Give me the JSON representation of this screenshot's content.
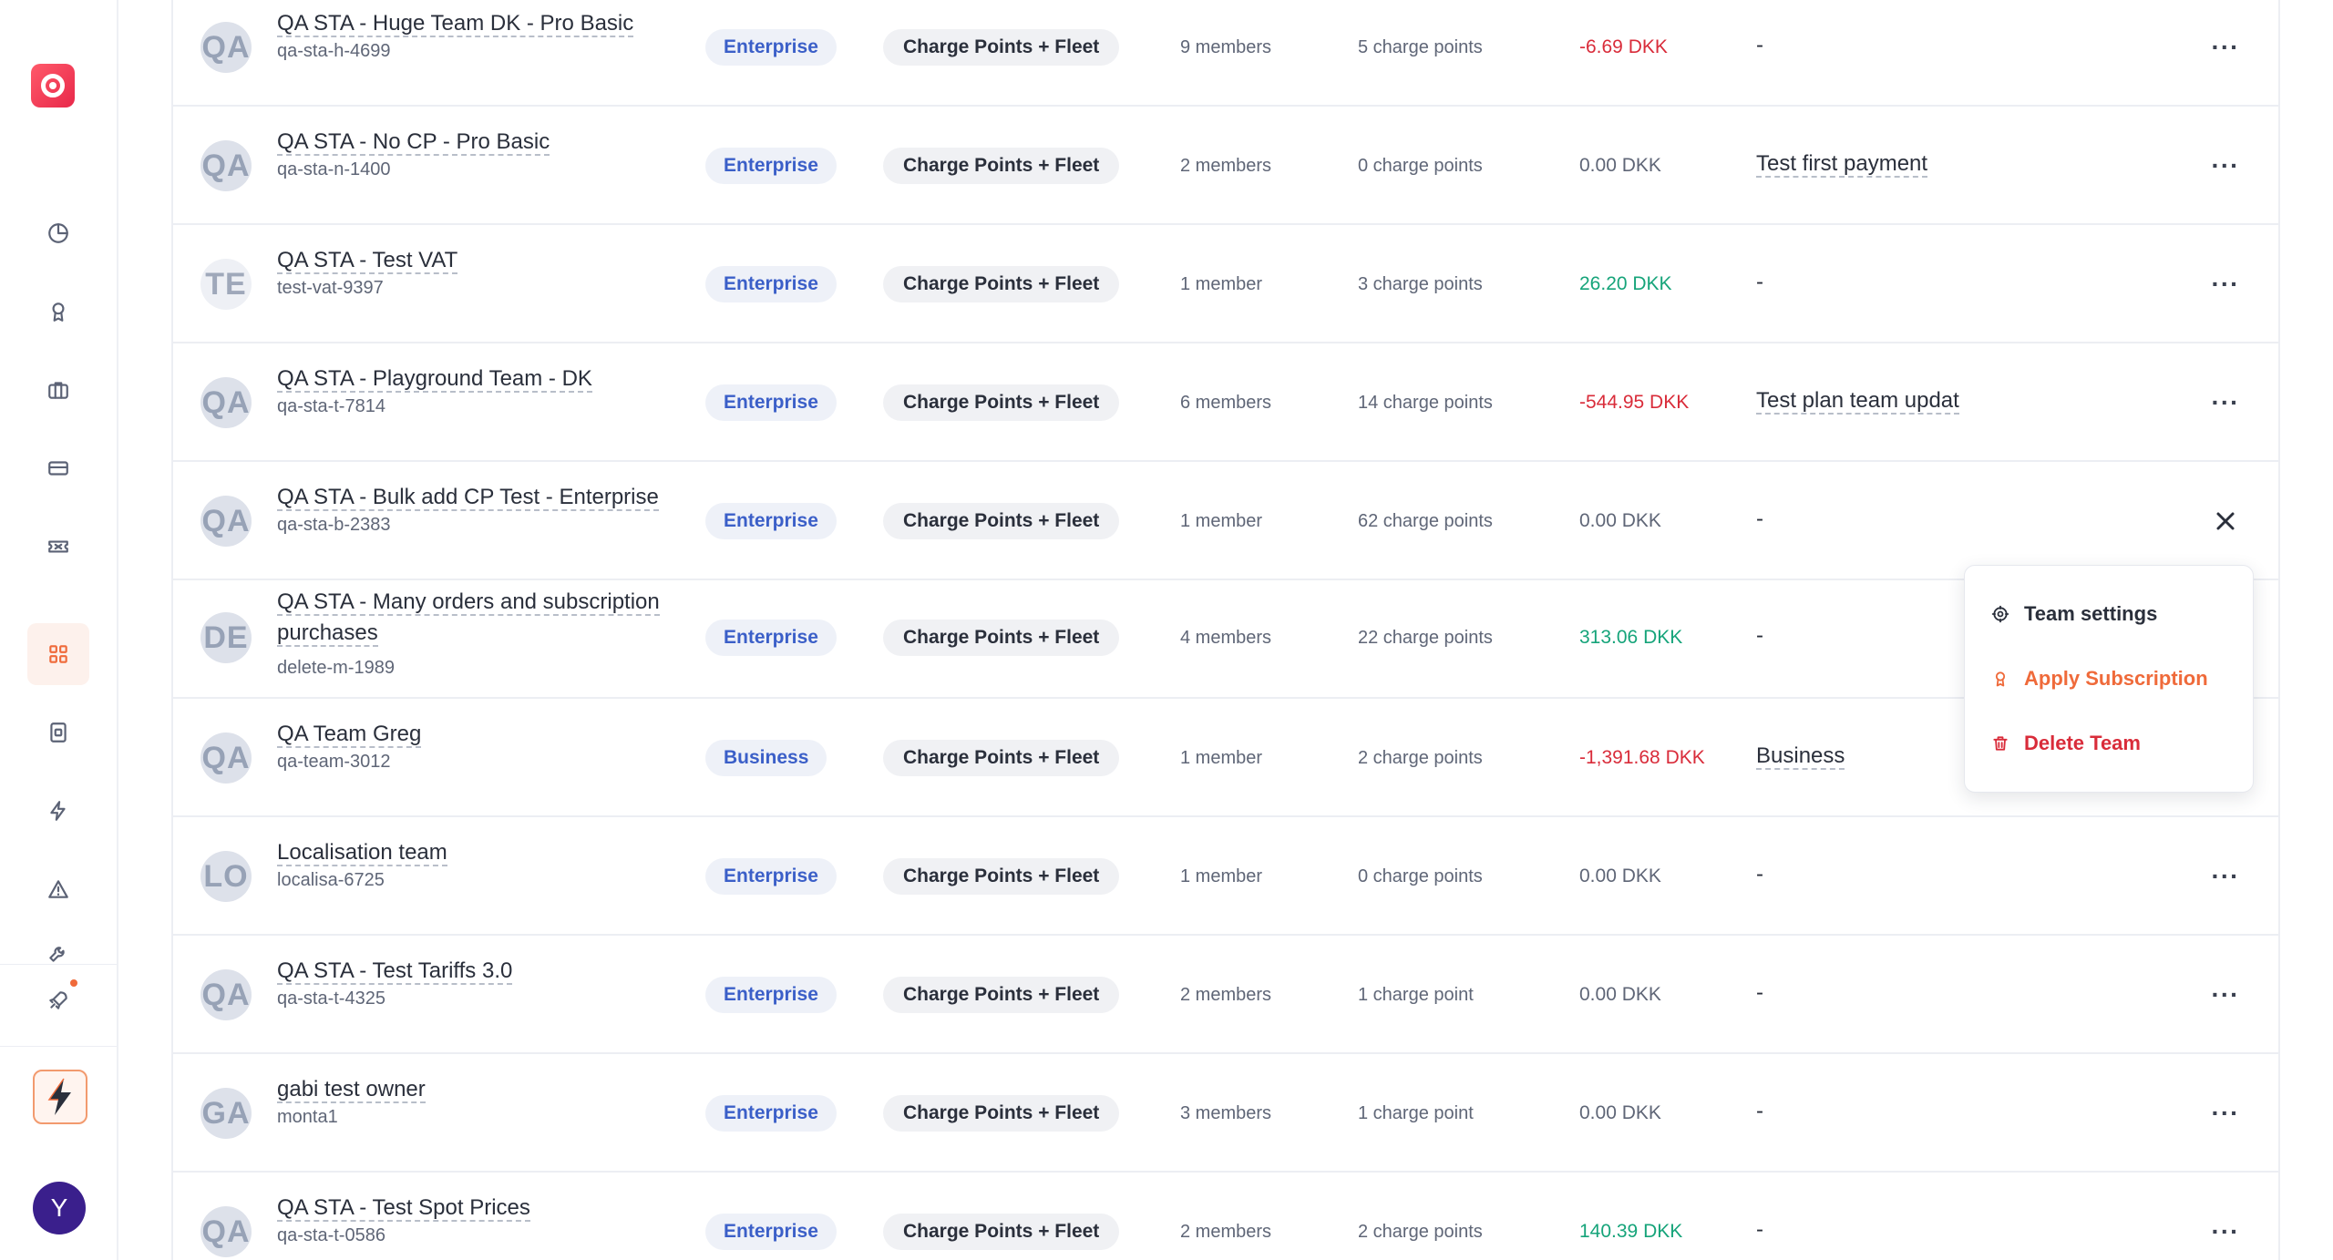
{
  "sidebar": {
    "nav": [
      {
        "name": "dashboard-icon"
      },
      {
        "name": "subscriptions-icon"
      },
      {
        "name": "briefcase-icon"
      },
      {
        "name": "card-icon"
      },
      {
        "name": "ticket-icon"
      },
      {
        "name": "teams-grid-icon",
        "active": true
      },
      {
        "name": "device-icon"
      },
      {
        "name": "lightning-icon"
      },
      {
        "name": "warning-icon"
      },
      {
        "name": "tools-icon"
      },
      {
        "name": "rocket-icon"
      }
    ],
    "user_initial": "Y"
  },
  "teams": [
    {
      "initials": "QA",
      "name": "QA STA - Huge Team DK - Pro Basic",
      "id": "qa-sta-h-4699",
      "plan": "Enterprise",
      "type": "Charge Points + Fleet",
      "members": "9  members",
      "charge_points": "5  charge points",
      "balance": "-6.69 DKK",
      "balance_kind": "neg",
      "note": "-",
      "action": "···"
    },
    {
      "initials": "QA",
      "name": "QA STA - No CP - Pro Basic",
      "id": "qa-sta-n-1400",
      "plan": "Enterprise",
      "type": "Charge Points + Fleet",
      "members": "2  members",
      "charge_points": "0  charge points",
      "balance": "0.00 DKK",
      "balance_kind": "zero",
      "note": "Test first payment",
      "action": "···"
    },
    {
      "initials": "TE",
      "name": "QA STA - Test VAT",
      "id": "test-vat-9397",
      "plan": "Enterprise",
      "type": "Charge Points + Fleet",
      "members": "1 member",
      "charge_points": "3  charge points",
      "balance": "26.20 DKK",
      "balance_kind": "pos",
      "note": "-",
      "action": "···"
    },
    {
      "initials": "QA",
      "name": "QA STA - Playground Team - DK",
      "id": "qa-sta-t-7814",
      "plan": "Enterprise",
      "type": "Charge Points + Fleet",
      "members": "6  members",
      "charge_points": "14  charge points",
      "balance": "-544.95 DKK",
      "balance_kind": "neg",
      "note": "Test plan team updat",
      "action": "···"
    },
    {
      "initials": "QA",
      "name": "QA STA - Bulk add CP Test - Enterprise",
      "id": "qa-sta-b-2383",
      "plan": "Enterprise",
      "type": "Charge Points + Fleet",
      "members": "1 member",
      "charge_points": "62  charge points",
      "balance": "0.00 DKK",
      "balance_kind": "zero",
      "note": "-",
      "action": "×"
    },
    {
      "initials": "DE",
      "name": "QA STA - Many orders and subscription purchases",
      "id": "delete-m-1989",
      "plan": "Enterprise",
      "type": "Charge Points + Fleet",
      "members": "4  members",
      "charge_points": "22  charge points",
      "balance": "313.06 DKK",
      "balance_kind": "pos",
      "note": "-",
      "action": ""
    },
    {
      "initials": "QA",
      "name": "QA Team Greg",
      "id": "qa-team-3012",
      "plan": "Business",
      "type": "Charge Points + Fleet",
      "members": "1 member",
      "charge_points": "2  charge points",
      "balance": "-1,391.68 DKK",
      "balance_kind": "neg",
      "note": "Business",
      "action": ""
    },
    {
      "initials": "LO",
      "name": "Localisation team",
      "id": "localisa-6725",
      "plan": "Enterprise",
      "type": "Charge Points + Fleet",
      "members": "1 member",
      "charge_points": "0  charge points",
      "balance": "0.00 DKK",
      "balance_kind": "zero",
      "note": "-",
      "action": "···"
    },
    {
      "initials": "QA",
      "name": "QA STA - Test Tariffs 3.0",
      "id": "qa-sta-t-4325",
      "plan": "Enterprise",
      "type": "Charge Points + Fleet",
      "members": "2  members",
      "charge_points": "1 charge point",
      "balance": "0.00 DKK",
      "balance_kind": "zero",
      "note": "-",
      "action": "···"
    },
    {
      "initials": "GA",
      "name": "gabi test owner",
      "id": "monta1",
      "plan": "Enterprise",
      "type": "Charge Points + Fleet",
      "members": "3  members",
      "charge_points": "1 charge point",
      "balance": "0.00 DKK",
      "balance_kind": "zero",
      "note": "-",
      "action": "···"
    },
    {
      "initials": "QA",
      "name": "QA STA - Test Spot Prices",
      "id": "qa-sta-t-0586",
      "plan": "Enterprise",
      "type": "Charge Points + Fleet",
      "members": "2  members",
      "charge_points": "2  charge points",
      "balance": "140.39 DKK",
      "balance_kind": "pos",
      "note": "-",
      "action": "···"
    }
  ],
  "menu": {
    "team_settings": "Team settings",
    "apply_subscription": "Apply Subscription",
    "delete_team": "Delete Team"
  },
  "colors": {
    "accent": "#ef6a3a",
    "plan_text": "#3b5fc8",
    "negative": "#d92c3a",
    "positive": "#16a47a"
  }
}
